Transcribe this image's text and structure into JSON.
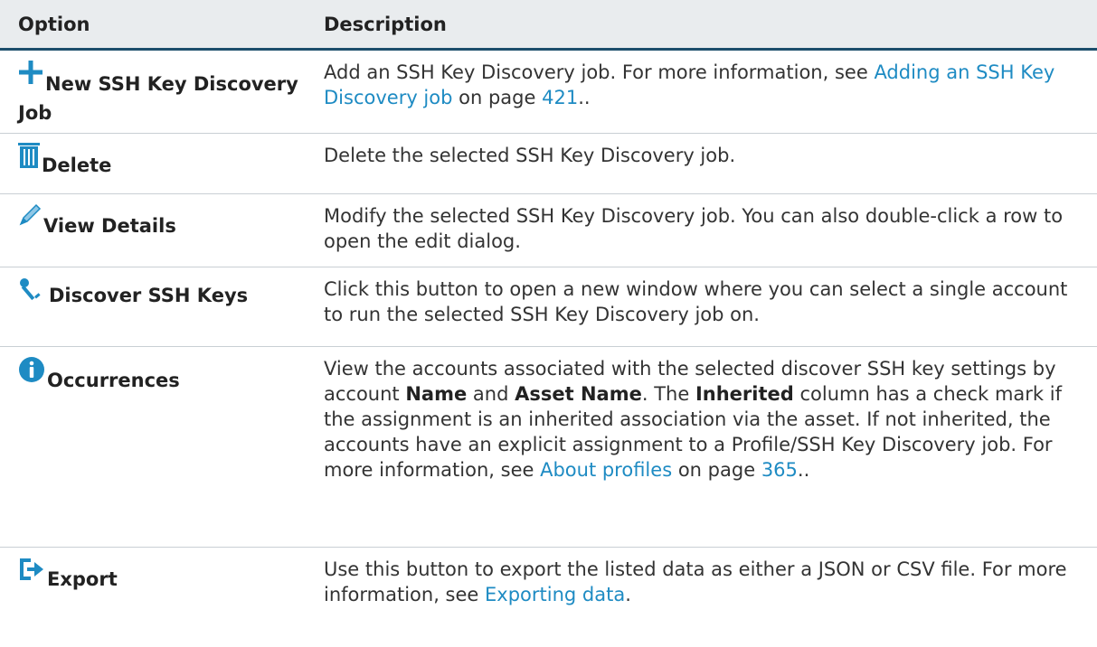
{
  "table": {
    "header": {
      "option": "Option",
      "description": "Description"
    },
    "rows": [
      {
        "option": "New SSH Key Discovery Job",
        "icon": "plus-icon",
        "desc_text": "Add an SSH Key Discovery job. For more information, see",
        "desc_link": "Adding an SSH Key Discovery job",
        "desc_on_page": "on page",
        "desc_page": "421",
        "desc_end": ".."
      },
      {
        "option": "Delete",
        "icon": "trash-icon",
        "desc": "Delete the selected SSH Key Discovery job."
      },
      {
        "option": "View Details",
        "icon": "pencil-icon",
        "desc": "Modify the selected SSH Key Discovery job. You can also double-click a row to open the edit dialog."
      },
      {
        "option": "Discover SSH Keys",
        "icon": "key-icon",
        "desc": "Click this button to open a new window where you can select a single account to run the selected SSH Key Discovery job on."
      },
      {
        "option": "Occurrences",
        "icon": "info-icon",
        "desc_1": "View the accounts associated with the selected discover SSH key settings by account",
        "bold_name": "Name",
        "desc_and": "and",
        "bold_asset_name": "Asset Name",
        "desc_the": ". The",
        "bold_inherited": "Inherited",
        "desc_2": "column has a check mark if the assignment is an inherited association via the asset. If not inherited, the accounts have an explicit assignment to a Profile/SSH Key Discovery job. For more information, see",
        "desc_link": "About profiles",
        "desc_on_page": "on page",
        "desc_page": "365",
        "desc_end": ".."
      },
      {
        "option": "Export",
        "icon": "export-icon",
        "desc_text": "Use this button to export the listed data as either a JSON or CSV file. For more information, see",
        "desc_link": "Exporting data",
        "desc_end": "."
      }
    ]
  },
  "colors": {
    "accent": "#1e8bc3",
    "header_border": "#1c4e6b",
    "header_bg": "#e9ecee"
  }
}
